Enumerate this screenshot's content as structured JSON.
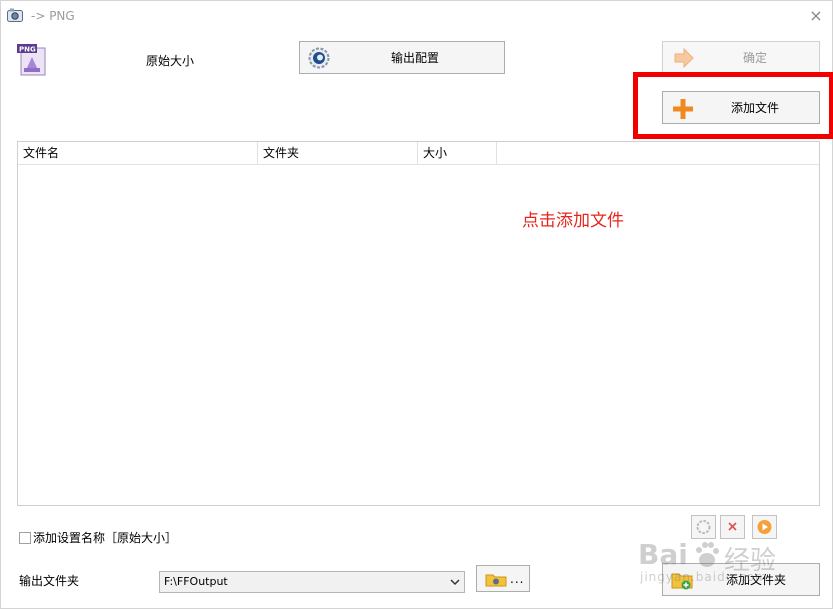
{
  "window": {
    "title": "-> PNG",
    "close_glyph": "×"
  },
  "top": {
    "format_icon": "png-file-icon",
    "format_badge": "PNG",
    "original_size_label": "原始大小",
    "output_config_button": "输出配置",
    "ok_button": "确定",
    "add_file_button": "添加文件"
  },
  "file_list": {
    "columns": [
      "文件名",
      "文件夹",
      "大小"
    ],
    "rows": [],
    "hint_text": "点击添加文件"
  },
  "bottom": {
    "add_setting_name_checkbox": "添加设置名称［原始大小］",
    "add_setting_name_checked": false,
    "output_folder_label": "输出文件夹",
    "output_folder_value": "F:\\FFOutput",
    "browse_button": "...",
    "add_folder_button": "添加文件夹"
  },
  "watermark": {
    "brand": "Bai",
    "brand_tail": "经验",
    "sub": "jingyan.baidu.com"
  },
  "colors": {
    "highlight": "#f20000",
    "hint": "#e8251d",
    "add_icon": "#f08a1c"
  }
}
